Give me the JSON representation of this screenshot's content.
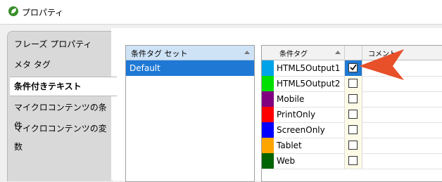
{
  "window": {
    "title": "プロパティ"
  },
  "tabs": [
    {
      "label": "フレーズ プロパティ"
    },
    {
      "label": "メタ タグ"
    },
    {
      "label": "条件付きテキスト",
      "active": true
    },
    {
      "label": "マイクロコンテンツの条件"
    },
    {
      "label": "マイクロコンテンツの変数"
    }
  ],
  "condition_sets": {
    "header": "条件タグ セット",
    "items": [
      {
        "label": "Default",
        "selected": true
      }
    ]
  },
  "condition_tags": {
    "columns": {
      "tag": "条件タグ",
      "comment": "コメント"
    },
    "rows": [
      {
        "name": "HTML5Output1",
        "color": "#00a2e8",
        "checked": true,
        "selected": true
      },
      {
        "name": "HTML5Output2",
        "color": "#00e000",
        "checked": false
      },
      {
        "name": "Mobile",
        "color": "#800080",
        "checked": false
      },
      {
        "name": "PrintOnly",
        "color": "#ff0000",
        "checked": false
      },
      {
        "name": "ScreenOnly",
        "color": "#0000ff",
        "checked": false
      },
      {
        "name": "Tablet",
        "color": "#ffa500",
        "checked": false
      },
      {
        "name": "Web",
        "color": "#006400",
        "checked": false
      }
    ]
  },
  "colors": {
    "accent": "#1e78d4",
    "callout": "#e8502a"
  }
}
